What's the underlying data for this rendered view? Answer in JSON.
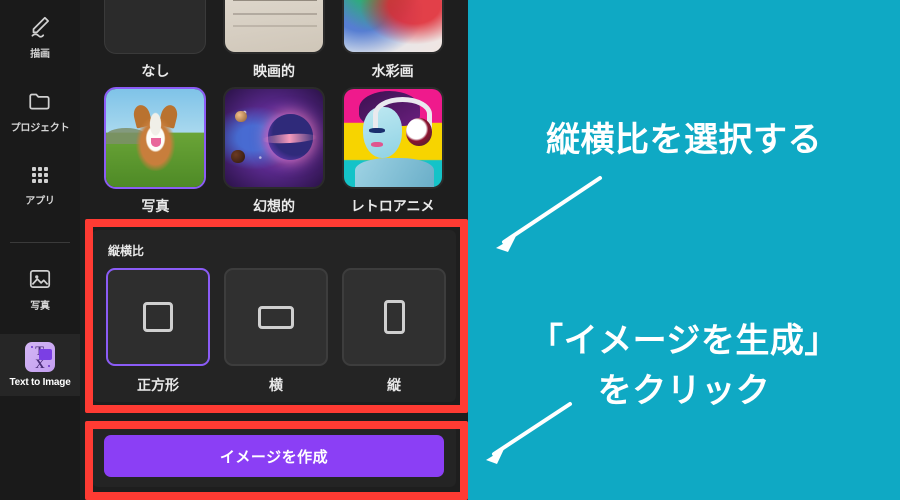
{
  "app": {
    "sidebar": {
      "items": [
        {
          "label": "描画",
          "icon": "pencil-draw-icon",
          "active": false
        },
        {
          "label": "プロジェクト",
          "icon": "folder-icon",
          "active": false
        },
        {
          "label": "アプリ",
          "icon": "grid-apps-icon",
          "active": false
        },
        {
          "label": "写真",
          "icon": "photo-image-icon",
          "active": false
        },
        {
          "label": "Text to Image",
          "icon": "text-to-image-icon",
          "active": true
        }
      ]
    },
    "styles": {
      "items": [
        {
          "label": "なし",
          "selected": false,
          "art": "none"
        },
        {
          "label": "映画的",
          "selected": false,
          "art": "cinematic"
        },
        {
          "label": "水彩画",
          "selected": false,
          "art": "watercolor"
        },
        {
          "label": "写真",
          "selected": true,
          "art": "photo"
        },
        {
          "label": "幻想的",
          "selected": false,
          "art": "fantasy"
        },
        {
          "label": "レトロアニメ",
          "selected": false,
          "art": "retro"
        }
      ]
    },
    "aspect_ratio": {
      "title": "縦横比",
      "options": [
        {
          "label": "正方形",
          "shape": "square-icon",
          "selected": true
        },
        {
          "label": "横",
          "shape": "landscape-rect-icon",
          "selected": false
        },
        {
          "label": "縦",
          "shape": "portrait-rect-icon",
          "selected": false
        }
      ]
    },
    "generate_button": {
      "label": "イメージを作成"
    }
  },
  "annotations": {
    "step1": "縦横比を選択する",
    "step2_line1": "「イメージを生成」",
    "step2_line2": "をクリック"
  },
  "colors": {
    "panel_background": "#1e1e1e",
    "rail_background": "#1a1a1a",
    "card_background": "#242424",
    "accent_purple": "#8b3ff5",
    "selection_purple": "#8b5cf6",
    "highlight_red": "#ff3b33",
    "annotation_teal": "#0fa9c4",
    "annotation_text": "#ffffff"
  }
}
